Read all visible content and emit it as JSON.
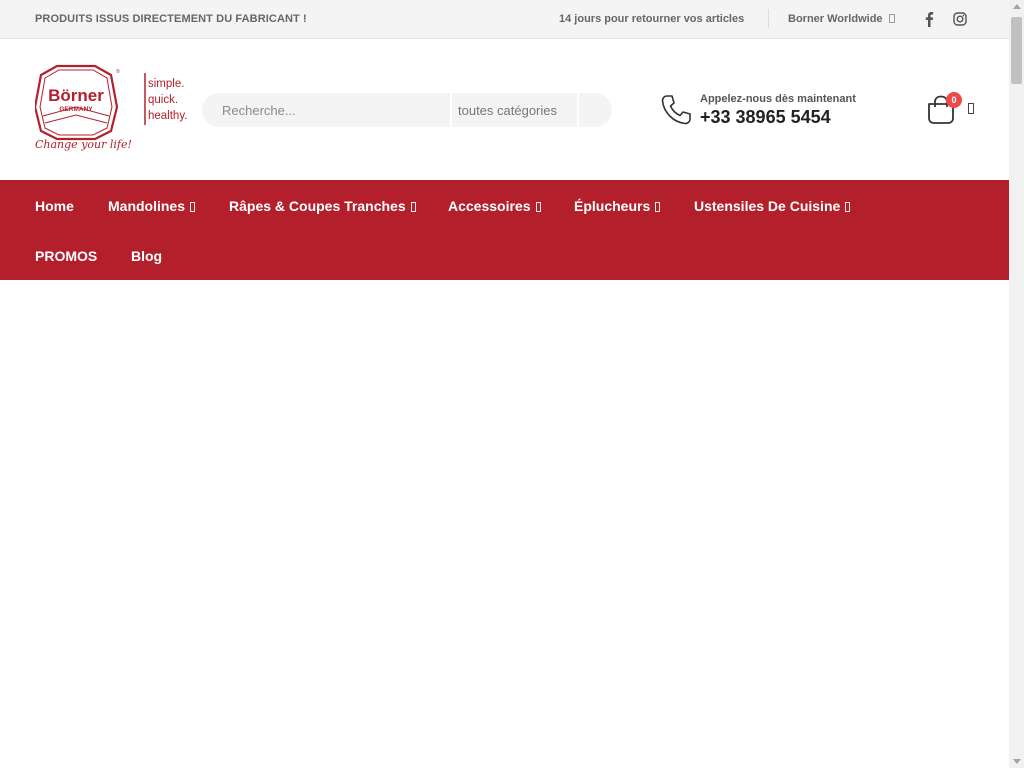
{
  "topbar": {
    "promo_text": "PRODUITS ISSUS DIRECTEMENT DU FABRICANT !",
    "returns_text": "14 jours pour retourner vos articles",
    "worldwide_label": "Borner Worldwide"
  },
  "header": {
    "search_placeholder": "Recherche...",
    "category_label": "toutes catégories",
    "call_label": "Appelez-nous dès maintenant",
    "phone_number": "+33 38965 5454",
    "cart_count": "0"
  },
  "logo": {
    "brand": "Börner",
    "country": "GERMANY",
    "tagline_lines": [
      "simple.",
      "quick.",
      "healthy."
    ],
    "slogan": "Change your life!"
  },
  "nav": {
    "items": [
      {
        "label": "Home"
      },
      {
        "label": "Mandolines"
      },
      {
        "label": "Râpes & Coupes Tranches"
      },
      {
        "label": "Accessoires"
      },
      {
        "label": "Éplucheurs"
      },
      {
        "label": "Ustensiles De Cuisine"
      },
      {
        "label": "PROMOS"
      },
      {
        "label": "Blog"
      }
    ]
  },
  "colors": {
    "brand_red": "#b3202c",
    "badge_red": "#ef4a4a"
  }
}
